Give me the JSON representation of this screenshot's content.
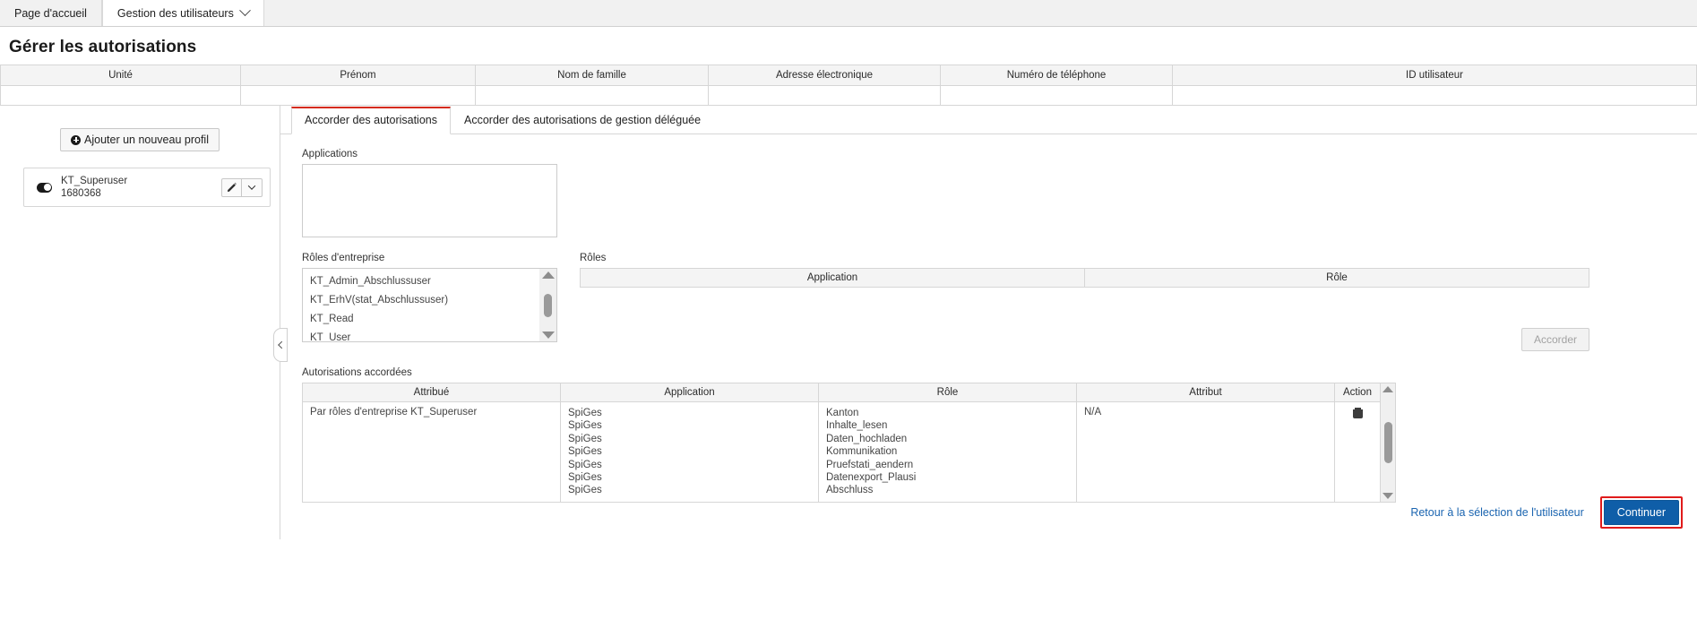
{
  "nav": {
    "tabs": [
      {
        "label": "Page d'accueil",
        "active": false,
        "has_chevron": false
      },
      {
        "label": "Gestion des utilisateurs",
        "active": true,
        "has_chevron": true
      }
    ]
  },
  "page": {
    "title": "Gérer les autorisations"
  },
  "user_table": {
    "columns": [
      "Unité",
      "Prénom",
      "Nom de famille",
      "Adresse électronique",
      "Numéro de téléphone",
      "ID utilisateur"
    ],
    "rows": [
      [
        "",
        "",
        "",
        "",
        "",
        ""
      ]
    ]
  },
  "sidebar": {
    "add_profile_label": "Ajouter un nouveau profil",
    "add_profile_icon": "plus-circle-icon",
    "profiles": [
      {
        "name": "KT_Superuser",
        "id": "1680368",
        "enabled": true,
        "edit_icon": "pencil-icon",
        "menu_icon": "chevron-down-icon"
      }
    ],
    "collapse_icon": "chevron-left-icon"
  },
  "panel": {
    "tabs": [
      {
        "label": "Accorder des autorisations",
        "active": true
      },
      {
        "label": "Accorder des autorisations de gestion déléguée",
        "active": false
      }
    ],
    "applications": {
      "label": "Applications",
      "items": []
    },
    "enterprise_roles": {
      "label": "Rôles d'entreprise",
      "items": [
        "KT_Admin_Abschlussuser",
        "KT_ErhV(stat_Abschlussuser)",
        "KT_Read",
        "KT_User"
      ],
      "scroll_up_icon": "triangle-up-icon",
      "scroll_down_icon": "triangle-down-icon"
    },
    "roles": {
      "label": "Rôles",
      "columns": [
        "Application",
        "Rôle"
      ],
      "rows": []
    },
    "grant_button_label": "Accorder"
  },
  "granted": {
    "label": "Autorisations accordées",
    "columns": [
      "Attribué",
      "Application",
      "Rôle",
      "Attribut",
      "Action"
    ],
    "rows": [
      {
        "attributed": "Par rôles d'entreprise KT_Superuser",
        "applications": [
          "SpiGes",
          "SpiGes",
          "SpiGes",
          "SpiGes",
          "SpiGes",
          "SpiGes",
          "SpiGes"
        ],
        "roles": [
          "Kanton",
          "Inhalte_lesen",
          "Daten_hochladen",
          "Kommunikation",
          "Pruefstati_aendern",
          "Datenexport_Plausi",
          "Abschluss"
        ],
        "attribute": "N/A",
        "action_icon": "trash-icon"
      }
    ]
  },
  "footer": {
    "back_link": "Retour à la sélection de l'utilisateur",
    "continue_label": "Continuer",
    "continue_highlight_color": "#e01b1b",
    "continue_bg_color": "#0f5ea8",
    "active_tab_accent_color": "#d52b1e"
  }
}
